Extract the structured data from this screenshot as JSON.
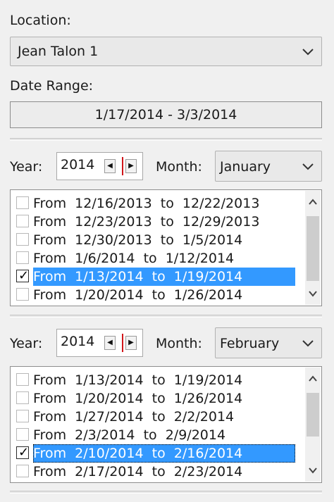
{
  "location": {
    "label": "Location:",
    "selected": "Jean Talon 1"
  },
  "date_range": {
    "label": "Date Range:",
    "value": "1/17/2014 - 3/3/2014"
  },
  "panels": [
    {
      "year_label": "Year:",
      "year_value": "2014",
      "month_label": "Month:",
      "month_value": "January",
      "weeks": [
        {
          "text": "From  12/16/2013  to  12/22/2013",
          "checked": false,
          "selected": false
        },
        {
          "text": "From  12/23/2013  to  12/29/2013",
          "checked": false,
          "selected": false
        },
        {
          "text": "From  12/30/2013  to  1/5/2014",
          "checked": false,
          "selected": false
        },
        {
          "text": "From  1/6/2014  to  1/12/2014",
          "checked": false,
          "selected": false
        },
        {
          "text": "From  1/13/2014  to  1/19/2014",
          "checked": true,
          "selected": true
        },
        {
          "text": "From  1/20/2014  to  1/26/2014",
          "checked": false,
          "selected": false
        }
      ]
    },
    {
      "year_label": "Year:",
      "year_value": "2014",
      "month_label": "Month:",
      "month_value": "February",
      "weeks": [
        {
          "text": "From  1/13/2014  to  1/19/2014",
          "checked": false,
          "selected": false
        },
        {
          "text": "From  1/20/2014  to  1/26/2014",
          "checked": false,
          "selected": false
        },
        {
          "text": "From  1/27/2014  to  2/2/2014",
          "checked": false,
          "selected": false
        },
        {
          "text": "From  2/3/2014  to  2/9/2014",
          "checked": false,
          "selected": false
        },
        {
          "text": "From  2/10/2014  to  2/16/2014",
          "checked": true,
          "selected": true
        },
        {
          "text": "From  2/17/2014  to  2/23/2014",
          "checked": false,
          "selected": false
        }
      ]
    }
  ],
  "icons": {
    "dropdown": "chevron-down-icon",
    "spin_left": "arrow-left-icon",
    "spin_right": "arrow-right-icon",
    "scroll_up": "chevron-up-icon",
    "scroll_down": "chevron-down-icon",
    "check": "checkmark-icon"
  },
  "colors": {
    "selection": "#3399ff",
    "spinner_divider": "#d0151a",
    "background": "#f0f0f0"
  }
}
